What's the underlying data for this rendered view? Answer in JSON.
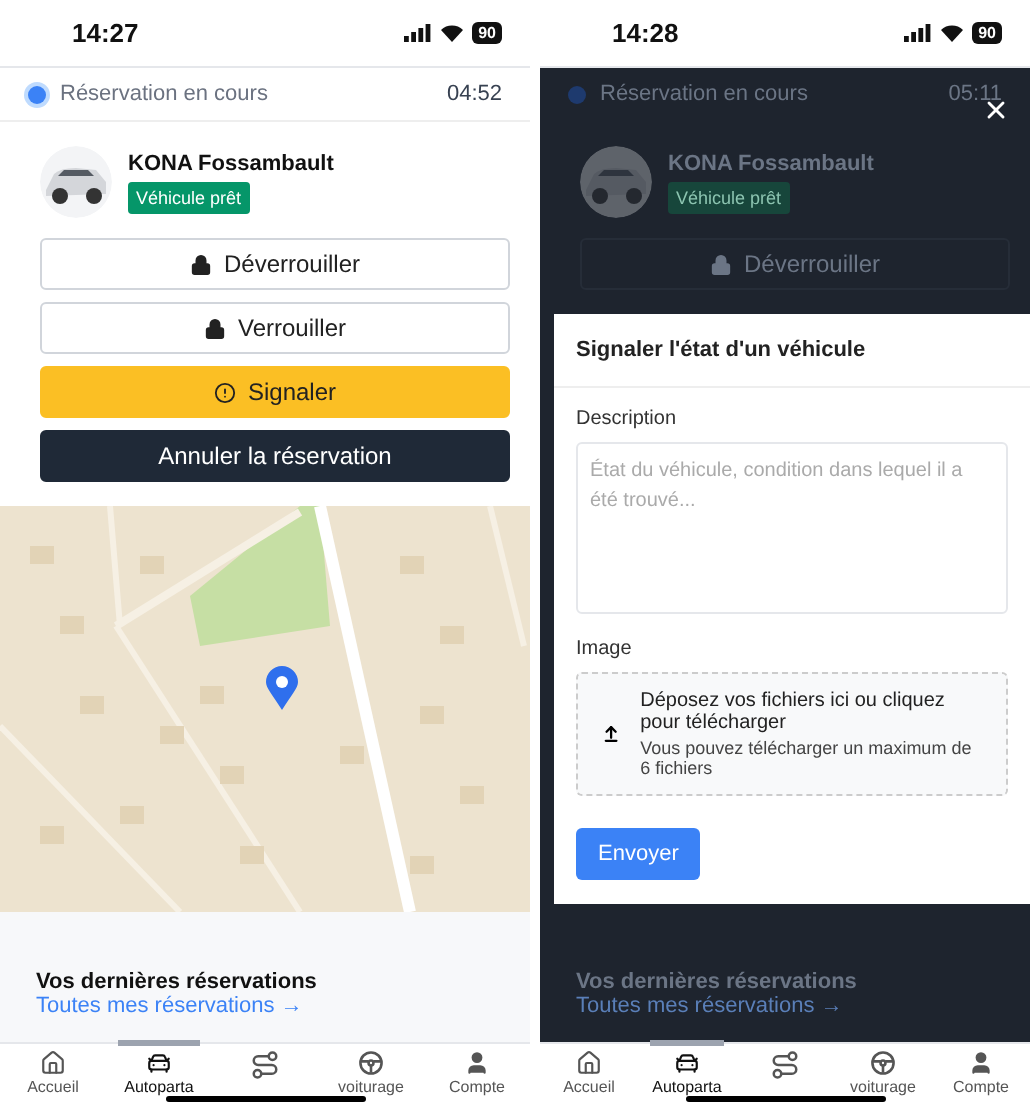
{
  "screens": [
    {
      "kind": "main",
      "status_bar": {
        "time": "14:27",
        "battery": "90"
      },
      "reservation": {
        "label": "Réservation en cours",
        "timer": "04:52"
      },
      "vehicle": {
        "name": "KONA Fossambault",
        "badge": "Véhicule prêt"
      },
      "actions": [
        {
          "kind": "outline",
          "label": "Déverrouiller"
        },
        {
          "kind": "outline",
          "label": "Verrouiller"
        },
        {
          "kind": "warning",
          "label": "Signaler"
        },
        {
          "kind": "dark",
          "label": "Annuler la réservation"
        }
      ],
      "map": {
        "kind": "picture"
      },
      "recent": {
        "title": "Vos dernières réservations",
        "link": "Toutes mes réservations →"
      },
      "tabs": [
        {
          "label": "Accueil",
          "selected": false
        },
        {
          "label": "Autoparta",
          "selected": true
        },
        {
          "selected": false
        },
        {
          "label": "voiturage",
          "selected": false
        },
        {
          "label": "Compte",
          "selected": false
        }
      ]
    },
    {
      "kind": "modal",
      "status_bar": {
        "time": "14:28",
        "battery": "90"
      },
      "reservation": {
        "label": "Réservation en cours",
        "timer": "05:11"
      },
      "vehicle": {
        "name": "KONA Fossambault",
        "badge": "Véhicule prêt"
      },
      "actions": [
        {
          "kind": "outline",
          "label": "Déverrouiller"
        }
      ],
      "dialog": {
        "title": "Signaler l'état d'un véhicule",
        "description_label": "Description",
        "description_placeholder": "État du véhicule, condition dans lequel il a été trouvé...",
        "image_label": "Image",
        "drop_text": "Déposez vos fichiers ici ou cliquez pour télécharger",
        "drop_hint": "Vous pouvez télécharger un maximum de 6 fichiers",
        "submit": "Envoyer"
      },
      "recent": {
        "title": "Vos dernières réservations",
        "link": "Toutes mes réservations →"
      },
      "tabs": [
        {
          "label": "Accueil",
          "selected": false
        },
        {
          "label": "Autoparta",
          "selected": true
        },
        {
          "selected": false
        },
        {
          "label": "voiturage",
          "selected": false
        },
        {
          "label": "Compte",
          "selected": false
        }
      ]
    }
  ]
}
